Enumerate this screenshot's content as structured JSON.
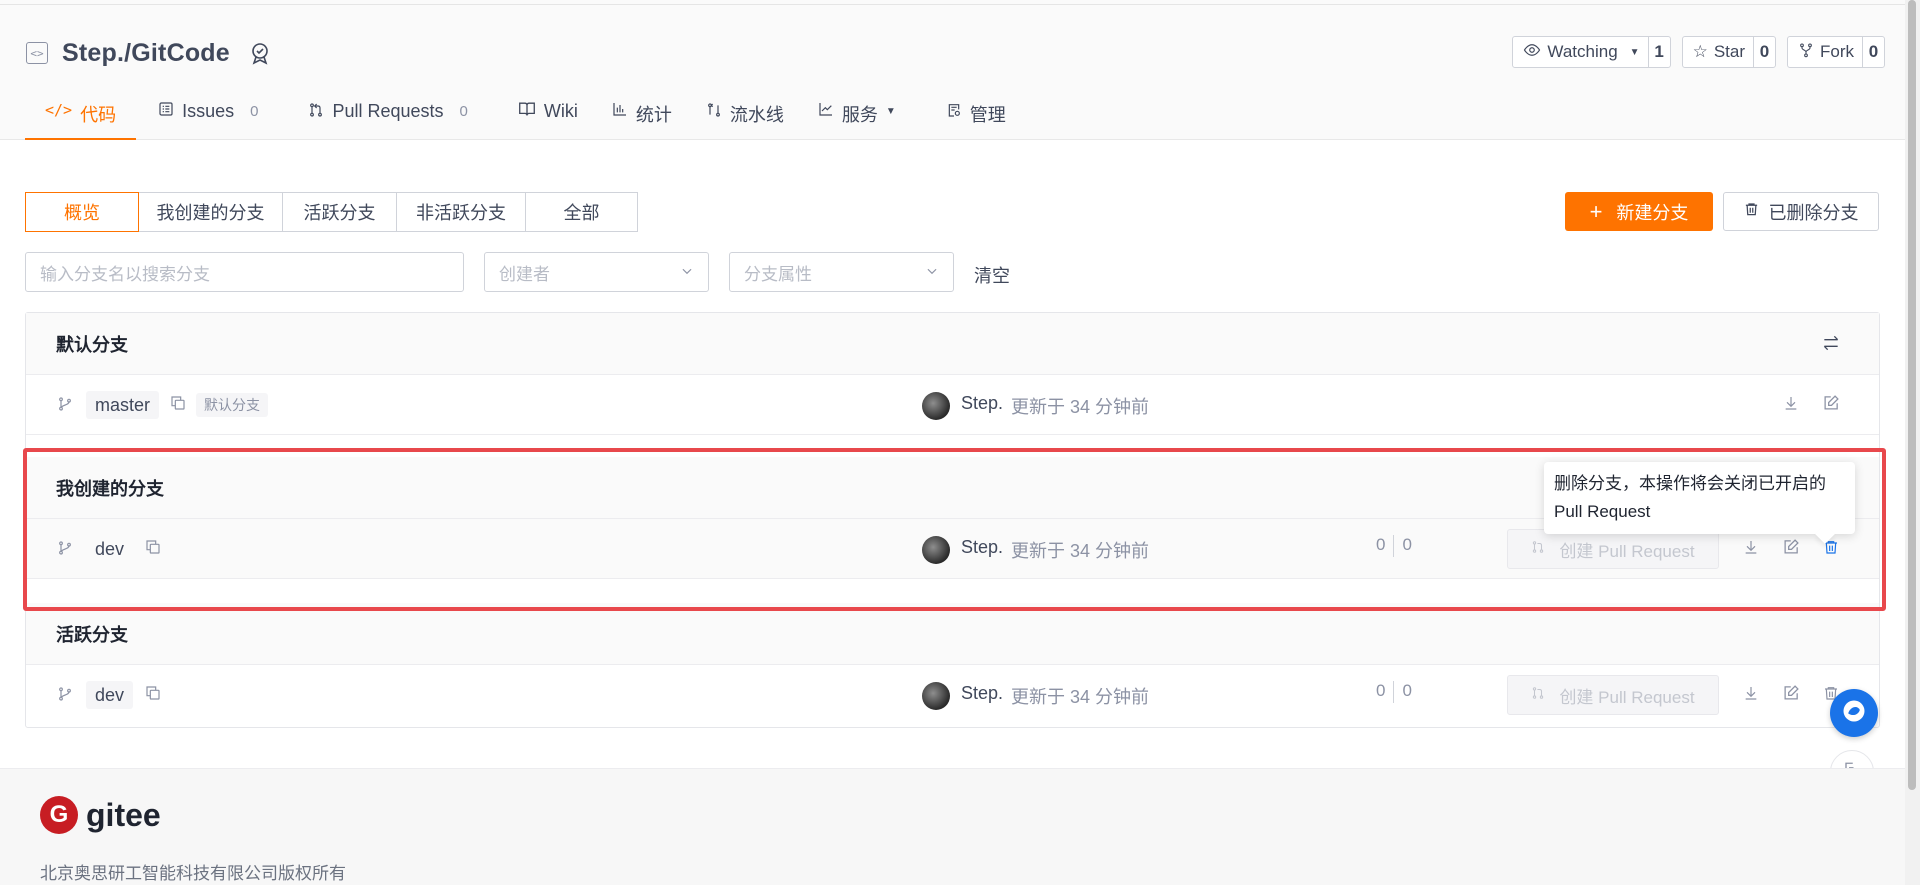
{
  "repo": {
    "title": "Step./GitCode"
  },
  "actions": {
    "watch": {
      "label": "Watching",
      "count": "1"
    },
    "star": {
      "label": "Star",
      "count": "0"
    },
    "fork": {
      "label": "Fork",
      "count": "0"
    }
  },
  "tabs": [
    {
      "label": "代码",
      "icon": "code-icon"
    },
    {
      "label": "Issues",
      "count": "0",
      "icon": "issues-icon"
    },
    {
      "label": "Pull Requests",
      "count": "0",
      "icon": "pull-request-icon"
    },
    {
      "label": "Wiki",
      "icon": "book-icon"
    },
    {
      "label": "统计",
      "icon": "chart-icon"
    },
    {
      "label": "流水线",
      "icon": "pipeline-icon"
    },
    {
      "label": "服务",
      "icon": "trend-icon"
    },
    {
      "label": "管理",
      "icon": "settings-doc-icon"
    }
  ],
  "filters_seg": [
    "概览",
    "我创建的分支",
    "活跃分支",
    "非活跃分支",
    "全部"
  ],
  "buttons": {
    "new_branch": "新建分支",
    "deleted": "已删除分支"
  },
  "search": {
    "placeholder": "输入分支名以搜索分支",
    "creator": "创建者",
    "attr": "分支属性",
    "clear": "清空"
  },
  "sections": {
    "default": {
      "title": "默认分支",
      "branch": {
        "name": "master",
        "tag": "默认分支",
        "author": "Step.",
        "updated": "更新于 34 分钟前"
      }
    },
    "mine": {
      "title": "我创建的分支",
      "branch": {
        "name": "dev",
        "author": "Step.",
        "updated": "更新于 34 分钟前",
        "behind": "0",
        "ahead": "0",
        "pr": "创建 Pull Request"
      }
    },
    "active": {
      "title": "活跃分支",
      "branch": {
        "name": "dev",
        "author": "Step.",
        "updated": "更新于 34 分钟前",
        "behind": "0",
        "ahead": "0",
        "pr": "创建 Pull Request"
      }
    }
  },
  "tooltip": {
    "line1": "删除分支，本操作将会关闭已开启的",
    "line2": "Pull Request"
  },
  "footer": {
    "logo": "gitee",
    "logo_mark": "G",
    "copyright": "北京奥思研工智能科技有限公司版权所有"
  },
  "colors": {
    "accent": "#fe7300",
    "highlight_border": "#e8484c",
    "delete_icon": "#1a73e8"
  }
}
